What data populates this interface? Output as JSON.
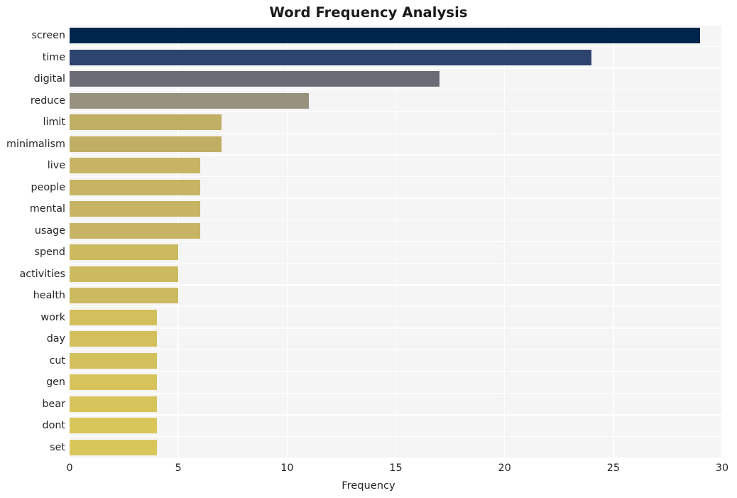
{
  "chart_data": {
    "type": "bar",
    "orientation": "horizontal",
    "title": "Word Frequency Analysis",
    "xlabel": "Frequency",
    "ylabel": "",
    "xlim": [
      0,
      30
    ],
    "ylim": [
      0,
      20
    ],
    "xticks": [
      0,
      5,
      10,
      15,
      20,
      25,
      30
    ],
    "xticklabels": [
      "0",
      "5",
      "10",
      "15",
      "20",
      "25",
      "30"
    ],
    "grid": true,
    "grid_color": "#ffffff",
    "plot_background": "#f5f5f5",
    "figure_background": "#ffffff",
    "legend": null,
    "categories": [
      "screen",
      "time",
      "digital",
      "reduce",
      "limit",
      "minimalism",
      "live",
      "people",
      "mental",
      "usage",
      "spend",
      "activities",
      "health",
      "work",
      "day",
      "cut",
      "gen",
      "bear",
      "dont",
      "set"
    ],
    "values": [
      29,
      24,
      17,
      11,
      7,
      7,
      6,
      6,
      6,
      6,
      5,
      5,
      5,
      4,
      4,
      4,
      4,
      4,
      4,
      4
    ],
    "bar_colors": [
      "#00254d",
      "#2d4370",
      "#6a6b75",
      "#989180",
      "#bfae64",
      "#bfae64",
      "#c6b464",
      "#c6b464",
      "#c6b464",
      "#c6b464",
      "#ccba60",
      "#ccba60",
      "#ccba60",
      "#d3c05c",
      "#d3c05c",
      "#d3c05c",
      "#d6c45b",
      "#d6c45b",
      "#d8c65a",
      "#d8c65a"
    ],
    "bars": [
      {
        "label": "screen",
        "value": 29,
        "color": "#00254d"
      },
      {
        "label": "time",
        "value": 24,
        "color": "#2d4370"
      },
      {
        "label": "digital",
        "value": 17,
        "color": "#6a6b75"
      },
      {
        "label": "reduce",
        "value": 11,
        "color": "#989180"
      },
      {
        "label": "limit",
        "value": 7,
        "color": "#bfae64"
      },
      {
        "label": "minimalism",
        "value": 7,
        "color": "#bfae64"
      },
      {
        "label": "live",
        "value": 6,
        "color": "#c6b464"
      },
      {
        "label": "people",
        "value": 6,
        "color": "#c6b464"
      },
      {
        "label": "mental",
        "value": 6,
        "color": "#c6b464"
      },
      {
        "label": "usage",
        "value": 6,
        "color": "#c6b464"
      },
      {
        "label": "spend",
        "value": 5,
        "color": "#ccba60"
      },
      {
        "label": "activities",
        "value": 5,
        "color": "#ccba60"
      },
      {
        "label": "health",
        "value": 5,
        "color": "#ccba60"
      },
      {
        "label": "work",
        "value": 4,
        "color": "#d3c05c"
      },
      {
        "label": "day",
        "value": 4,
        "color": "#d3c05c"
      },
      {
        "label": "cut",
        "value": 4,
        "color": "#d3c05c"
      },
      {
        "label": "gen",
        "value": 4,
        "color": "#d6c45b"
      },
      {
        "label": "bear",
        "value": 4,
        "color": "#d6c45b"
      },
      {
        "label": "dont",
        "value": 4,
        "color": "#d8c65a"
      },
      {
        "label": "set",
        "value": 4,
        "color": "#d8c65a"
      }
    ]
  }
}
